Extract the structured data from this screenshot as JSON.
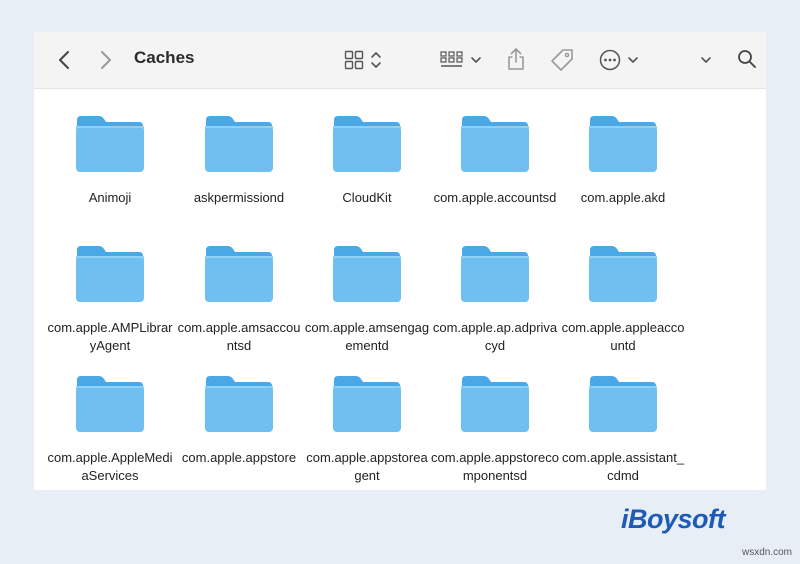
{
  "window": {
    "title": "Caches",
    "toolbar_icons": [
      "chevron-left-icon",
      "chevron-right-icon",
      "view-grid-icon",
      "group-icon",
      "share-icon",
      "tag-icon",
      "more-icon",
      "chevron-down-icon",
      "search-icon"
    ]
  },
  "colors": {
    "background": "#e8eef6",
    "folder_body": "#6fc0f1",
    "folder_tab": "#4aa8e6",
    "brand": "#1e5bb8"
  },
  "items": [
    {
      "label": "Animoji",
      "icon": "folder-icon"
    },
    {
      "label": "askpermissiond",
      "icon": "folder-icon"
    },
    {
      "label": "CloudKit",
      "icon": "folder-icon"
    },
    {
      "label": "com.apple.accountsd",
      "icon": "folder-icon"
    },
    {
      "label": "com.apple.akd",
      "icon": "folder-icon"
    },
    {
      "label": "com.apple.AMPLibraryAgent",
      "icon": "folder-icon"
    },
    {
      "label": "com.apple.amsaccountsd",
      "icon": "folder-icon"
    },
    {
      "label": "com.apple.amsengagementd",
      "icon": "folder-icon"
    },
    {
      "label": "com.apple.ap.adprivacyd",
      "icon": "folder-icon"
    },
    {
      "label": "com.apple.appleaccountd",
      "icon": "folder-icon"
    },
    {
      "label": "com.apple.AppleMediaServices",
      "icon": "folder-icon"
    },
    {
      "label": "com.apple.appstore",
      "icon": "folder-icon"
    },
    {
      "label": "com.apple.appstoreagent",
      "icon": "folder-icon"
    },
    {
      "label": "com.apple.appstorecomponentsd",
      "icon": "folder-icon"
    },
    {
      "label": "com.apple.assistant_cdmd",
      "icon": "folder-icon"
    }
  ],
  "brand": "iBoysoft",
  "watermark": "wsxdn.com"
}
